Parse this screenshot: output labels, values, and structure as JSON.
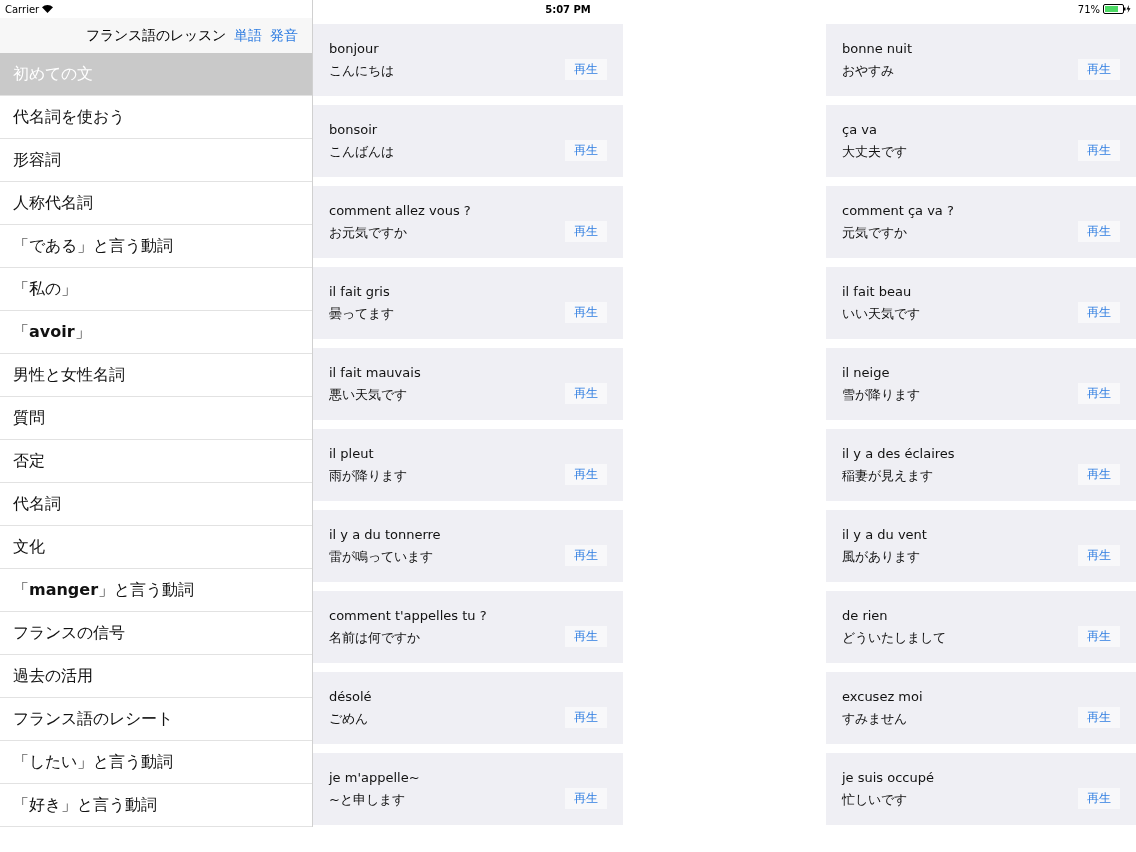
{
  "status_bar": {
    "carrier": "Carrier",
    "time": "5:07 PM",
    "battery": "71%"
  },
  "navigation": {
    "title": "フランス語のレッスン",
    "buttons": [
      "単語",
      "発音"
    ]
  },
  "sidebar": {
    "items": [
      {
        "label": "初めての文",
        "selected": true
      },
      {
        "label": "代名詞を使おう",
        "selected": false
      },
      {
        "label": "形容詞",
        "selected": false
      },
      {
        "label": "人称代名詞",
        "selected": false
      },
      {
        "label": "「である」と言う動詞",
        "selected": false
      },
      {
        "label": "「私の」",
        "selected": false
      },
      {
        "label": "「**avoir**」",
        "selected": false
      },
      {
        "label": "男性と女性名詞",
        "selected": false
      },
      {
        "label": "質問",
        "selected": false
      },
      {
        "label": "否定",
        "selected": false
      },
      {
        "label": "代名詞",
        "selected": false
      },
      {
        "label": "文化",
        "selected": false
      },
      {
        "label": "「**manger**」と言う動詞",
        "selected": false
      },
      {
        "label": "フランスの信号",
        "selected": false
      },
      {
        "label": "過去の活用",
        "selected": false
      },
      {
        "label": "フランス語のレシート",
        "selected": false
      },
      {
        "label": "「したい」と言う動詞",
        "selected": false
      },
      {
        "label": "「好き」と言う動詞",
        "selected": false
      }
    ]
  },
  "phrases": [
    {
      "french": "bonjour",
      "japanese": "こんにちは",
      "button": "再生"
    },
    {
      "french": "bonne nuit",
      "japanese": "おやすみ",
      "button": "再生"
    },
    {
      "french": "bonsoir",
      "japanese": "こんばんは",
      "button": "再生"
    },
    {
      "french": "ça va",
      "japanese": "大丈夫です",
      "button": "再生"
    },
    {
      "french": "comment allez vous ?",
      "japanese": "お元気ですか",
      "button": "再生"
    },
    {
      "french": "comment ça va ?",
      "japanese": "元気ですか",
      "button": "再生"
    },
    {
      "french": "il fait gris",
      "japanese": "曇ってます",
      "button": "再生"
    },
    {
      "french": "il fait beau",
      "japanese": "いい天気です",
      "button": "再生"
    },
    {
      "french": "il fait mauvais",
      "japanese": "悪い天気です",
      "button": "再生"
    },
    {
      "french": "il neige",
      "japanese": "雪が降ります",
      "button": "再生"
    },
    {
      "french": "il pleut",
      "japanese": "雨が降ります",
      "button": "再生"
    },
    {
      "french": "il y a des éclaires",
      "japanese": "稲妻が見えます",
      "button": "再生"
    },
    {
      "french": "il y a du tonnerre",
      "japanese": "雷が鳴っています",
      "button": "再生"
    },
    {
      "french": "il y a du vent",
      "japanese": "風があります",
      "button": "再生"
    },
    {
      "french": "comment t'appelles tu ?",
      "japanese": "名前は何ですか",
      "button": "再生"
    },
    {
      "french": "de rien",
      "japanese": "どういたしまして",
      "button": "再生"
    },
    {
      "french": "désolé",
      "japanese": "ごめん",
      "button": "再生"
    },
    {
      "french": "excusez moi",
      "japanese": "すみません",
      "button": "再生"
    },
    {
      "french": "je m'appelle~",
      "japanese": "~と申します",
      "button": "再生"
    },
    {
      "french": "je suis occupé",
      "japanese": "忙しいです",
      "button": "再生"
    }
  ]
}
